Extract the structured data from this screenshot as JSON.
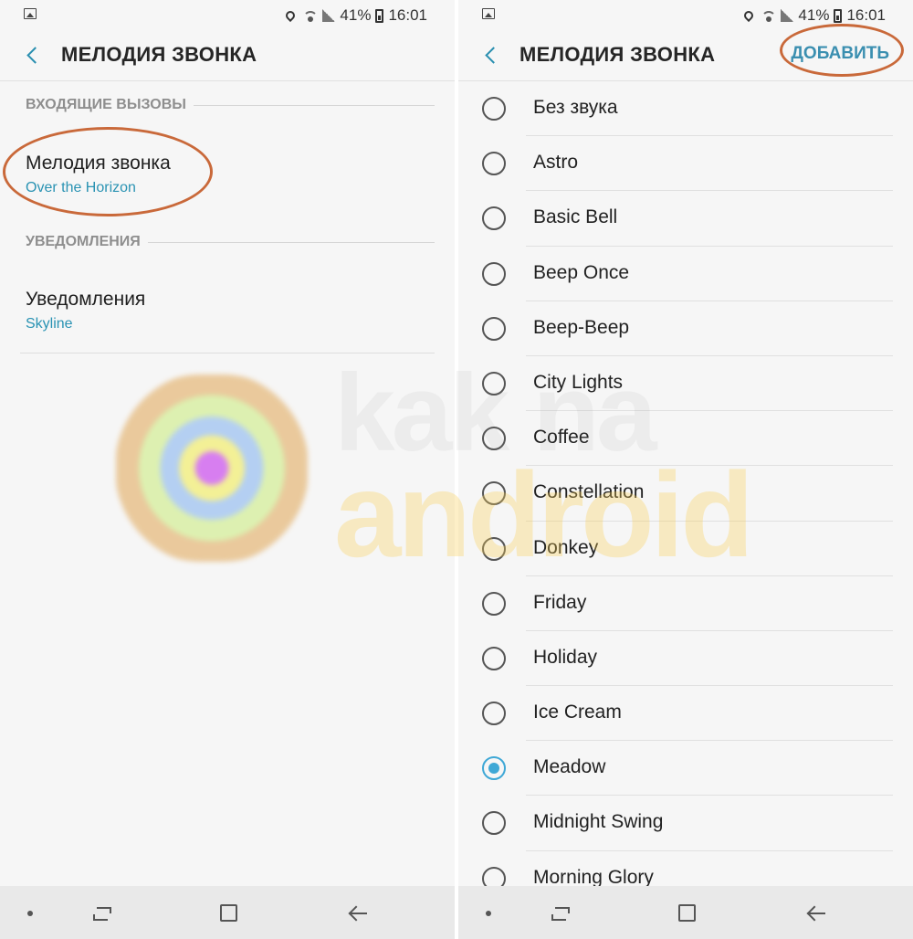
{
  "status_bar": {
    "battery": "41%",
    "time": "16:01"
  },
  "left": {
    "title": "МЕЛОДИЯ ЗВОНКА",
    "sections": [
      {
        "header": "ВХОДЯЩИЕ ВЫЗОВЫ",
        "title": "Мелодия звонка",
        "value": "Over the Horizon"
      },
      {
        "header": "УВЕДОМЛЕНИЯ",
        "title": "Уведомления",
        "value": "Skyline"
      }
    ]
  },
  "right": {
    "title": "МЕЛОДИЯ ЗВОНКА",
    "add_label": "ДОБАВИТЬ",
    "selected": "Meadow",
    "tones": [
      "Без звука",
      "Astro",
      "Basic Bell",
      "Beep Once",
      "Beep-Beep",
      "City Lights",
      "Coffee",
      "Constellation",
      "Donkey",
      "Friday",
      "Holiday",
      "Ice Cream",
      "Meadow",
      "Midnight Swing",
      "Morning Glory"
    ]
  },
  "watermark": {
    "line1": "kak na",
    "line2": "android"
  },
  "icons": {
    "status": [
      "gallery-icon",
      "location-icon",
      "wifi-icon",
      "signal-icon",
      "battery-icon"
    ],
    "nav": [
      "dot-icon",
      "recent-apps-icon",
      "home-icon",
      "back-arrow-icon"
    ]
  },
  "colors": {
    "accent": "#2a93b3",
    "highlight_ring": "#c9693a",
    "radio_selected": "#3fa8d6"
  }
}
